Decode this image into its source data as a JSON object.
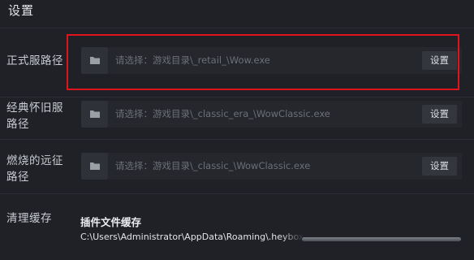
{
  "window": {
    "title": "设置"
  },
  "rows": [
    {
      "label": "正式服路径",
      "placeholder": "请选择：游戏目录\\_retail_\\Wow.exe",
      "button": "设置",
      "icon": "folder-icon"
    },
    {
      "label": "经典怀旧服路径",
      "placeholder": "请选择：游戏目录\\_classic_era_\\WowClassic.exe",
      "button": "设置",
      "icon": "folder-icon"
    },
    {
      "label": "燃烧的远征路径",
      "placeholder": "请选择：游戏目录\\_classic_\\WowClassic.exe",
      "button": "设置",
      "icon": "folder-icon"
    }
  ],
  "cache": {
    "label": "清理缓存",
    "title": "插件文件缓存",
    "path": "C:\\Users\\Administrator\\AppData\\Roaming\\.heybox"
  },
  "colors": {
    "background": "#1f2126",
    "highlight": "#e0141c",
    "placeholder_text": "#6c7078"
  }
}
